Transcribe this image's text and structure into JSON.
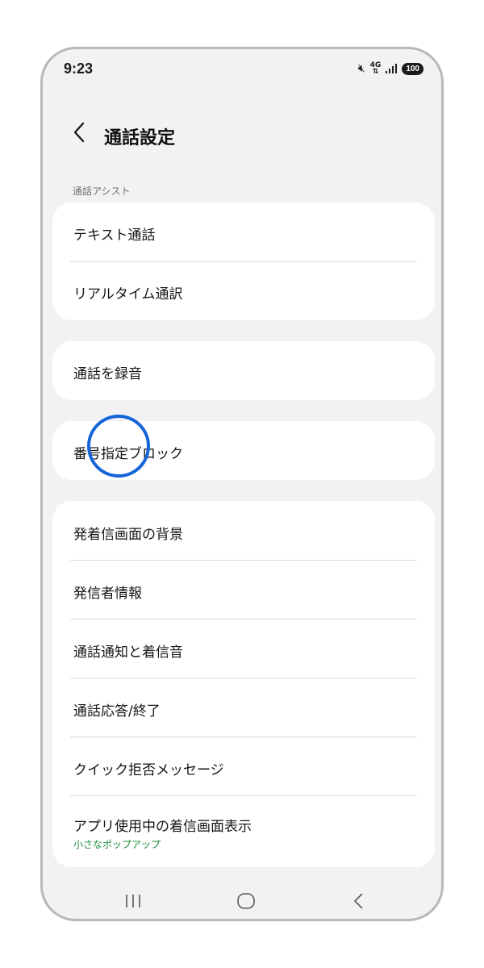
{
  "status_bar": {
    "time": "9:23",
    "network": "4G",
    "battery": "100",
    "icons": [
      "mute-icon",
      "network-4g-icon",
      "signal-icon",
      "battery-icon"
    ]
  },
  "header": {
    "back_icon": "chevron-left-icon",
    "title": "通話設定"
  },
  "sections": {
    "assist_header": "通話アシスト"
  },
  "cards": [
    {
      "items": [
        {
          "label": "テキスト通話"
        },
        {
          "label": "リアルタイム通訳"
        }
      ]
    },
    {
      "items": [
        {
          "label": "通話を録音"
        }
      ]
    },
    {
      "items": [
        {
          "label": "番号指定ブロック"
        }
      ]
    },
    {
      "items": [
        {
          "label": "発着信画面の背景"
        },
        {
          "label": "発信者情報"
        },
        {
          "label": "通話通知と着信音"
        },
        {
          "label": "通話応答/終了"
        },
        {
          "label": "クイック拒否メッセージ"
        },
        {
          "label": "アプリ使用中の着信画面表示",
          "sublabel": "小さなポップアップ"
        }
      ]
    }
  ],
  "nav_bar": {
    "buttons": [
      "recent-apps-icon",
      "home-icon",
      "back-icon"
    ]
  },
  "colors": {
    "background": "#f2f2f4",
    "card": "#ffffff",
    "sublabel_accent": "#1d8a3a",
    "tap_indicator": "#1565d8"
  }
}
